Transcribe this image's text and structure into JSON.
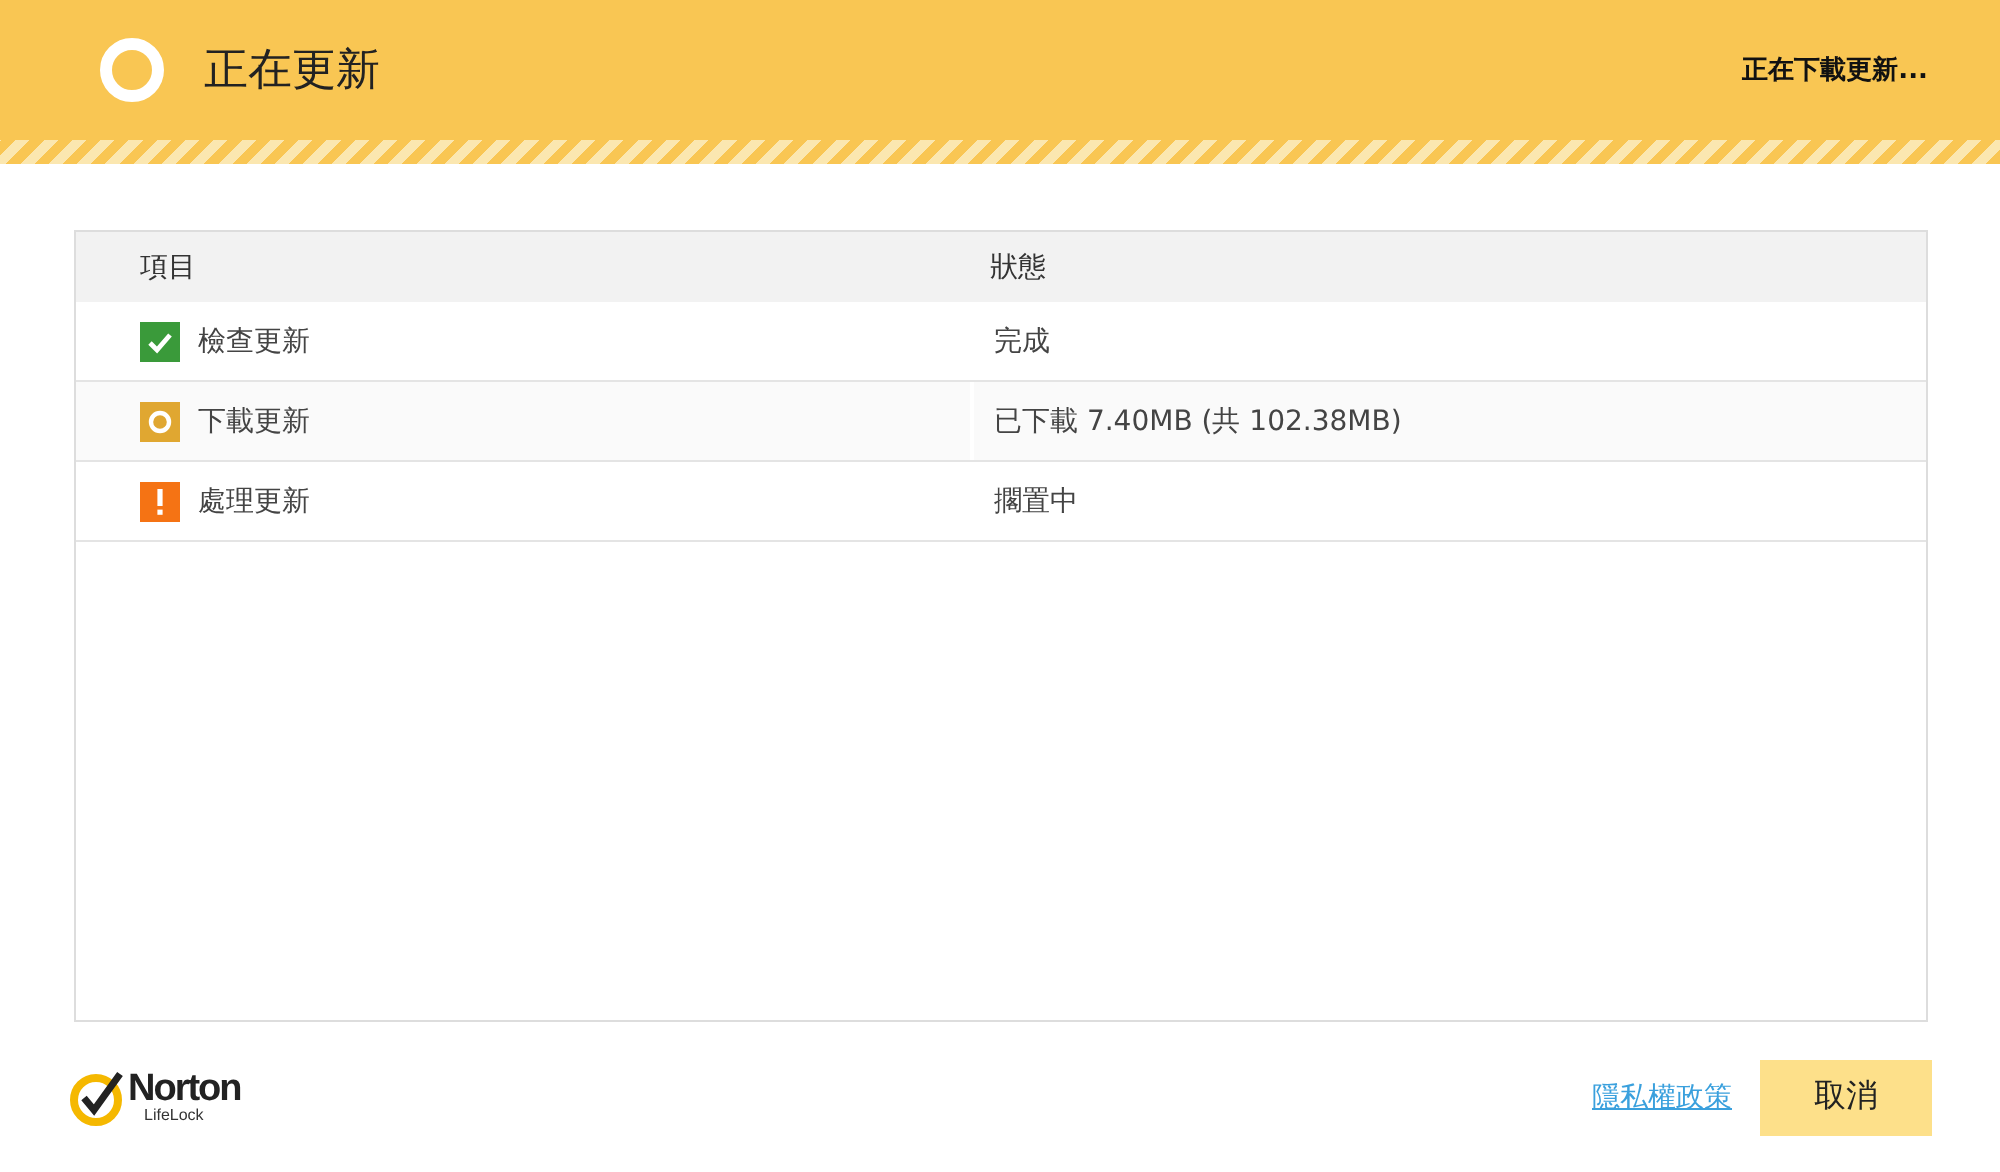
{
  "header": {
    "title": "正在更新",
    "status": "正在下載更新..."
  },
  "table": {
    "columns": [
      "項目",
      "狀態"
    ],
    "rows": [
      {
        "kind": "done",
        "item": "檢查更新",
        "status": "完成"
      },
      {
        "kind": "progress",
        "item": "下載更新",
        "status": "已下載 7.40MB (共 102.38MB)"
      },
      {
        "kind": "warning",
        "item": "處理更新",
        "status": "擱置中"
      }
    ]
  },
  "footer": {
    "logo": {
      "name": "Norton",
      "sub": "LifeLock"
    },
    "privacy_link": "隱私權政策",
    "cancel_button": "取消"
  }
}
